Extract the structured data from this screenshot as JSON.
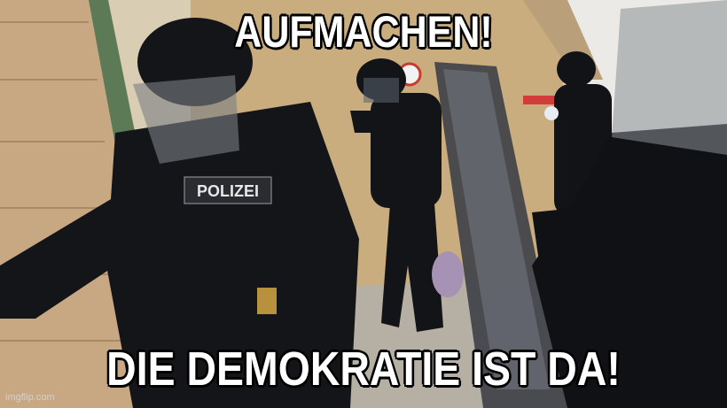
{
  "meme": {
    "top_text": "AUFMACHEN!",
    "bottom_text": "DIE DEMOKRATIE IST DA!"
  },
  "photo": {
    "vest_label": "POLIZEI",
    "colors": {
      "wall": "#d8c8a6",
      "door": "#c9ad7e",
      "uniform": "#121317",
      "floor": "#b6b0a4"
    }
  },
  "watermark": {
    "text": "imgflip.com"
  }
}
